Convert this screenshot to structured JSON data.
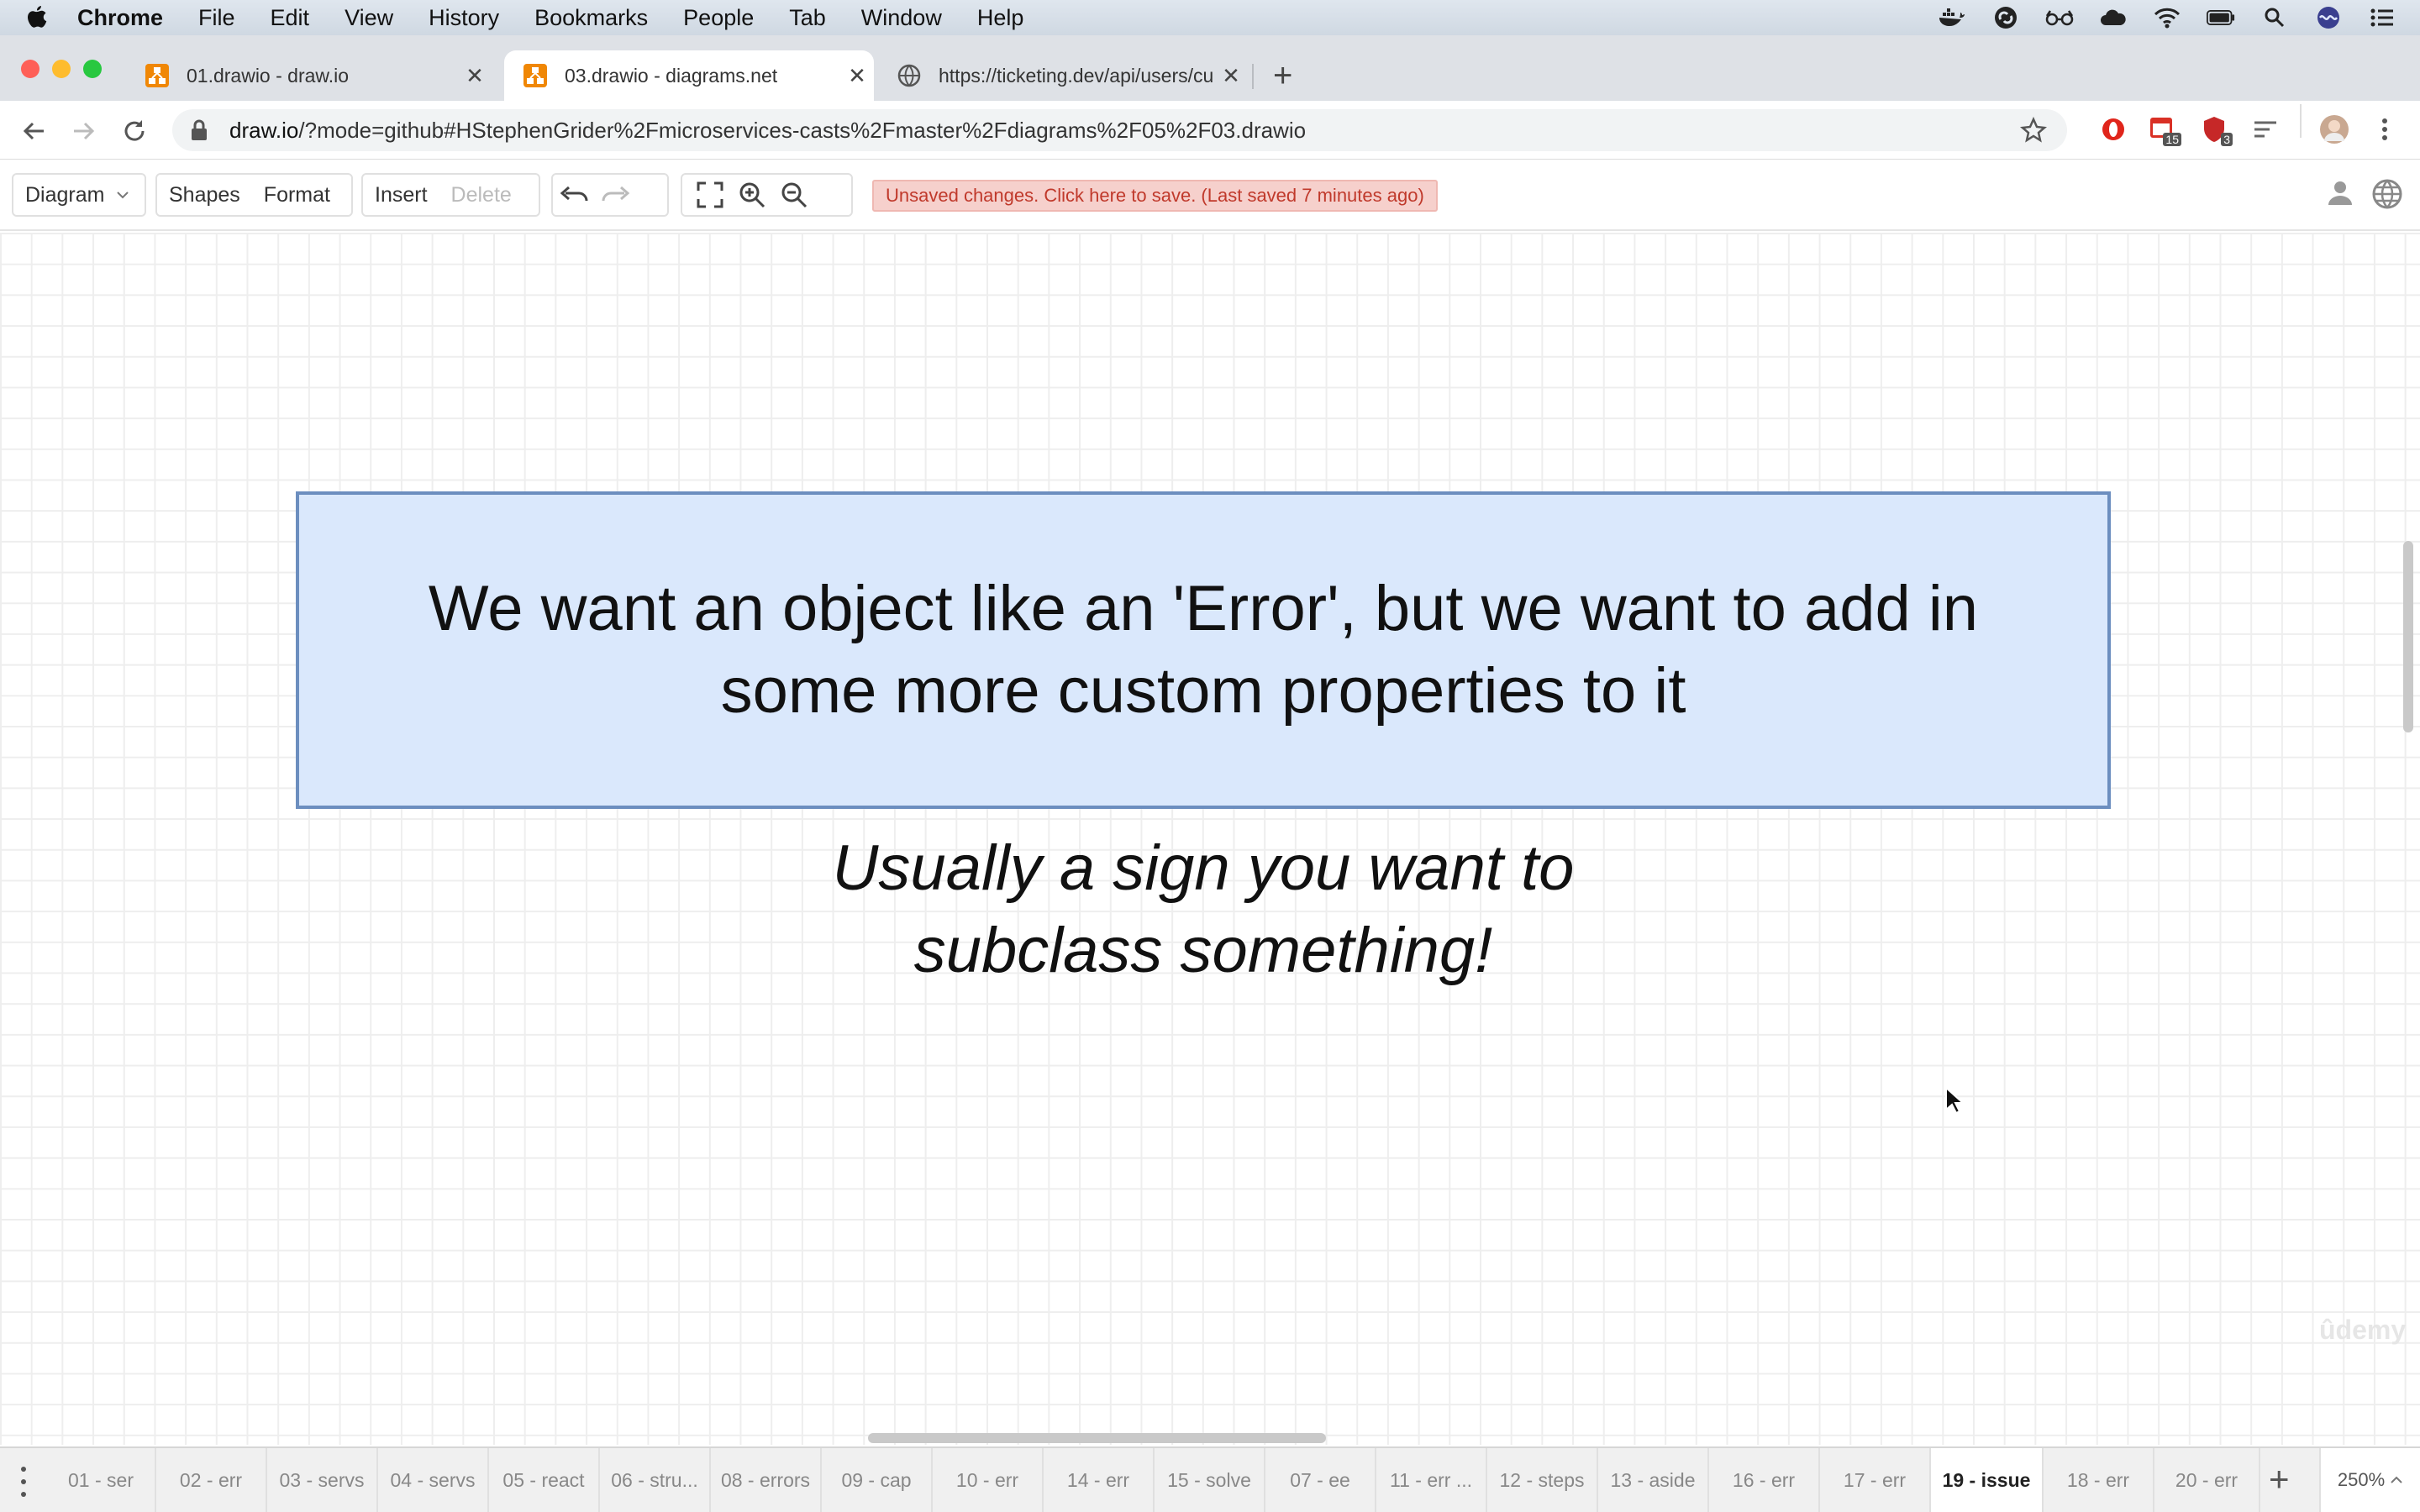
{
  "menubar": {
    "app": "Chrome",
    "items": [
      "File",
      "Edit",
      "View",
      "History",
      "Bookmarks",
      "People",
      "Tab",
      "Window",
      "Help"
    ],
    "status_icons": [
      "docker-icon",
      "creative-cloud-icon",
      "glasses-icon",
      "cloud-icon",
      "wifi-icon",
      "battery-icon",
      "spotlight-search-icon",
      "siri-icon",
      "control-center-icon"
    ]
  },
  "browser": {
    "tabs": [
      {
        "title": "01.drawio - draw.io",
        "active": false
      },
      {
        "title": "03.drawio - diagrams.net",
        "active": true
      },
      {
        "title": "https://ticketing.dev/api/users/cu",
        "active": false
      }
    ],
    "url_host": "draw.io",
    "url_rest": "/?mode=github#HStephenGrider%2Fmicroservices-casts%2Fmaster%2Fdiagrams%2F05%2F03.drawio",
    "ext_badges": [
      "15",
      "3"
    ]
  },
  "toolbar": {
    "diagram": "Diagram",
    "shapes": "Shapes",
    "format": "Format",
    "insert": "Insert",
    "delete": "Delete",
    "unsaved": "Unsaved changes. Click here to save. (Last saved 7 minutes ago)"
  },
  "canvas": {
    "box_line1": "We want an object like an 'Error', but we want to add in",
    "box_line2": "some more custom properties to it",
    "sub_line1": "Usually a sign you want to",
    "sub_line2": "subclass something!",
    "watermark": "ûdemy"
  },
  "pages": {
    "tabs": [
      "01 - ser",
      "02 - err",
      "03 - servs",
      "04 - servs",
      "05 - react",
      "06 - stru...",
      "08 - errors",
      "09 - cap",
      "10 - err",
      "14 - err",
      "15 - solve",
      "07 - ee",
      "11 - err ...",
      "12 - steps",
      "13 - aside",
      "16 - err",
      "17 - err",
      "19 - issue",
      "18 - err",
      "20 - err"
    ],
    "active": "19 - issue",
    "zoom": "250%"
  }
}
